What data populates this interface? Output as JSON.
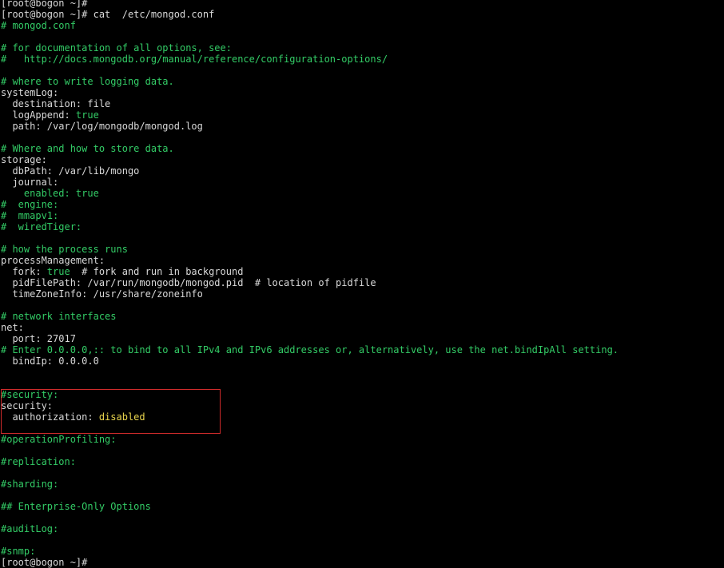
{
  "terminal": {
    "lines": [
      [
        {
          "t": "[root@bogon ~]#",
          "c": "white"
        }
      ],
      [
        {
          "t": "[root@bogon ~]# cat  /etc/mongod.conf",
          "c": "white"
        }
      ],
      [
        {
          "t": "# mongod.conf",
          "c": "green"
        }
      ],
      [],
      [
        {
          "t": "# for documentation of all options, see:",
          "c": "green"
        }
      ],
      [
        {
          "t": "#   http://docs.mongodb.org/manual/reference/configuration-options/",
          "c": "green"
        }
      ],
      [],
      [
        {
          "t": "# where to write logging data.",
          "c": "green"
        }
      ],
      [
        {
          "t": "systemLog:",
          "c": "white"
        }
      ],
      [
        {
          "t": "  destination: file",
          "c": "white"
        }
      ],
      [
        {
          "t": "  logAppend: ",
          "c": "white"
        },
        {
          "t": "true",
          "c": "green"
        }
      ],
      [
        {
          "t": "  path: /var/log/mongodb/mongod.log",
          "c": "white"
        }
      ],
      [],
      [
        {
          "t": "# Where and how to store data.",
          "c": "green"
        }
      ],
      [
        {
          "t": "storage:",
          "c": "white"
        }
      ],
      [
        {
          "t": "  dbPath: /var/lib/mongo",
          "c": "white"
        }
      ],
      [
        {
          "t": "  journal:",
          "c": "white"
        }
      ],
      [
        {
          "t": "    enabled: ",
          "c": "green"
        },
        {
          "t": "true",
          "c": "green"
        }
      ],
      [
        {
          "t": "#  engine:",
          "c": "green"
        }
      ],
      [
        {
          "t": "#  mmapv1:",
          "c": "green"
        }
      ],
      [
        {
          "t": "#  wiredTiger:",
          "c": "green"
        }
      ],
      [],
      [
        {
          "t": "# how the process runs",
          "c": "green"
        }
      ],
      [
        {
          "t": "processManagement:",
          "c": "white"
        }
      ],
      [
        {
          "t": "  fork: ",
          "c": "white"
        },
        {
          "t": "true",
          "c": "green"
        },
        {
          "t": "  # fork and run in background",
          "c": "white"
        }
      ],
      [
        {
          "t": "  pidFilePath: /var/run/mongodb/mongod.pid  # location of pidfile",
          "c": "white"
        }
      ],
      [
        {
          "t": "  timeZoneInfo: /usr/share/zoneinfo",
          "c": "white"
        }
      ],
      [],
      [
        {
          "t": "# network interfaces",
          "c": "green"
        }
      ],
      [
        {
          "t": "net:",
          "c": "white"
        }
      ],
      [
        {
          "t": "  port: 27017",
          "c": "white"
        }
      ],
      [
        {
          "t": "# Enter 0.0.0.0,:: to bind to all IPv4 and IPv6 addresses or, alternatively, use the net.bindIpAll setting.",
          "c": "green"
        }
      ],
      [
        {
          "t": "  bindIp: 0.0.0.0",
          "c": "white"
        }
      ],
      [],
      [],
      [
        {
          "t": "#security:",
          "c": "green"
        }
      ],
      [
        {
          "t": "security:",
          "c": "white"
        }
      ],
      [
        {
          "t": "  authorization: ",
          "c": "white"
        },
        {
          "t": "disabled",
          "c": "yellow"
        }
      ],
      [],
      [
        {
          "t": "#operationProfiling:",
          "c": "green"
        }
      ],
      [],
      [
        {
          "t": "#replication:",
          "c": "green"
        }
      ],
      [],
      [
        {
          "t": "#sharding:",
          "c": "green"
        }
      ],
      [],
      [
        {
          "t": "## Enterprise-Only Options",
          "c": "green"
        }
      ],
      [],
      [
        {
          "t": "#auditLog:",
          "c": "green"
        }
      ],
      [],
      [
        {
          "t": "#snmp:",
          "c": "green"
        }
      ],
      [
        {
          "t": "[root@bogon ~]#",
          "c": "white"
        }
      ]
    ]
  },
  "colors": {
    "background": "#000000",
    "text": "#d9d9d9",
    "comment": "#33cc66",
    "value_highlight": "#e8d44d",
    "annotation_box": "#d02b2b"
  }
}
